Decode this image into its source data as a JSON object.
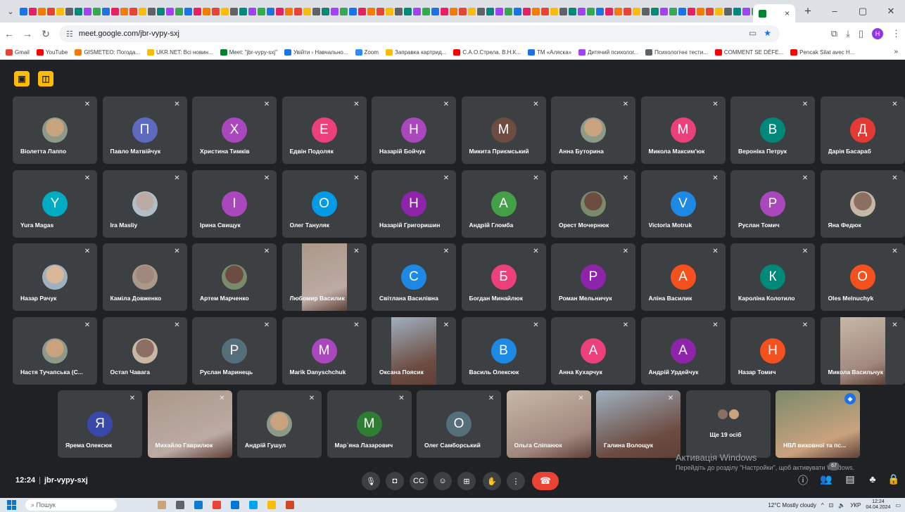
{
  "browser": {
    "url": "meet.google.com/jbr-vypy-sxj",
    "tab_close": "×",
    "new_tab": "+",
    "window_controls": [
      "–",
      "▢",
      "✕"
    ],
    "bookmarks": [
      {
        "label": "Gmail",
        "color": "#ea4335"
      },
      {
        "label": "YouTube",
        "color": "#ff0000"
      },
      {
        "label": "GISMETEO: Погода...",
        "color": "#f57c00"
      },
      {
        "label": "UKR.NET: Всі новин...",
        "color": "#fbbc04"
      },
      {
        "label": "Meet: \"jbr-vypy-sxj\"",
        "color": "#00832d"
      },
      {
        "label": "Увійти › Навчально...",
        "color": "#1a73e8"
      },
      {
        "label": "Zoom",
        "color": "#2d8cff"
      },
      {
        "label": "Заправка картрид...",
        "color": "#fbbc04"
      },
      {
        "label": "С.А.О.Стрела. В.Н.К...",
        "color": "#ff0000"
      },
      {
        "label": "ТМ «Аляска»",
        "color": "#1a73e8"
      },
      {
        "label": "Дитячий психолог...",
        "color": "#a142f4"
      },
      {
        "label": "Психологічні тести...",
        "color": "#5f6368"
      },
      {
        "label": "COMMENT SE DÉFE...",
        "color": "#ff0000"
      },
      {
        "label": "Pencak Silat avec H...",
        "color": "#ff0000"
      }
    ],
    "bookmarks_more": "»"
  },
  "meet": {
    "participants": [
      {
        "name": "Віолетта Лаппо",
        "initial": "",
        "color": "",
        "photo": true
      },
      {
        "name": "Павло Матвійчук",
        "initial": "П",
        "color": "#5c6bc0"
      },
      {
        "name": "Христина Тимків",
        "initial": "Х",
        "color": "#ab47bc"
      },
      {
        "name": "Едвін Подоляк",
        "initial": "Е",
        "color": "#ec407a"
      },
      {
        "name": "Назарій Бойчук",
        "initial": "Н",
        "color": "#ab47bc"
      },
      {
        "name": "Микита Приємський",
        "initial": "М",
        "color": "#6d4c41"
      },
      {
        "name": "Анна Буторина",
        "initial": "",
        "color": "",
        "photo": true
      },
      {
        "name": "Микола Максим'юк",
        "initial": "М",
        "color": "#ec407a"
      },
      {
        "name": "Вероніка Петрук",
        "initial": "В",
        "color": "#00897b"
      },
      {
        "name": "Дарія Басараб",
        "initial": "Д",
        "color": "#e53935"
      },
      {
        "name": "Yura Magas",
        "initial": "Y",
        "color": "#00acc1"
      },
      {
        "name": "Ira Masliy",
        "initial": "",
        "color": "",
        "photo": true
      },
      {
        "name": "Ірина Свищук",
        "initial": "І",
        "color": "#ab47bc"
      },
      {
        "name": "Олег Тануляк",
        "initial": "О",
        "color": "#039be5"
      },
      {
        "name": "Назарій Григоришин",
        "initial": "Н",
        "color": "#8e24aa"
      },
      {
        "name": "Андрій Гломба",
        "initial": "А",
        "color": "#43a047"
      },
      {
        "name": "Орест Мочернюк",
        "initial": "",
        "color": "",
        "photo": true
      },
      {
        "name": "Victoria Motruk",
        "initial": "V",
        "color": "#1e88e5"
      },
      {
        "name": "Руслан Томич",
        "initial": "Р",
        "color": "#ab47bc"
      },
      {
        "name": "Яна Федюк",
        "initial": "",
        "color": "",
        "photo": true
      },
      {
        "name": "Назар Рачук",
        "initial": "",
        "color": "",
        "photo": true
      },
      {
        "name": "Каміла Довженко",
        "initial": "",
        "color": "",
        "photo": true
      },
      {
        "name": "Артем Марченко",
        "initial": "",
        "color": "",
        "photo": true
      },
      {
        "name": "Любомир Василик",
        "initial": "",
        "color": "",
        "video": true
      },
      {
        "name": "Світлана Василівна",
        "initial": "С",
        "color": "#1e88e5"
      },
      {
        "name": "Богдан Минайлюк",
        "initial": "Б",
        "color": "#ec407a"
      },
      {
        "name": "Роман Мельничук",
        "initial": "Р",
        "color": "#8e24aa"
      },
      {
        "name": "Аліна Василик",
        "initial": "А",
        "color": "#f4511e"
      },
      {
        "name": "Кароліна Колотило",
        "initial": "К",
        "color": "#00897b"
      },
      {
        "name": "Oles Melnuchyk",
        "initial": "O",
        "color": "#f4511e"
      },
      {
        "name": "Настя Тучапська (С...",
        "initial": "",
        "color": "",
        "photo": true
      },
      {
        "name": "Остап Чавага",
        "initial": "",
        "color": "",
        "photo": true
      },
      {
        "name": "Руслан Маринець",
        "initial": "Р",
        "color": "#546e7a"
      },
      {
        "name": "Marik Danyschchuk",
        "initial": "M",
        "color": "#ab47bc"
      },
      {
        "name": "Оксана Поясик",
        "initial": "",
        "color": "",
        "video": true
      },
      {
        "name": "Василь Олексюк",
        "initial": "В",
        "color": "#1e88e5"
      },
      {
        "name": "Анна Кухарчук",
        "initial": "А",
        "color": "#ec407a"
      },
      {
        "name": "Андрій Урдейчук",
        "initial": "А",
        "color": "#8e24aa"
      },
      {
        "name": "Назар Томич",
        "initial": "Н",
        "color": "#f4511e"
      },
      {
        "name": "Микола Васильчук",
        "initial": "",
        "color": "",
        "video": true
      },
      {
        "name": "Ярема Олексюк",
        "initial": "Я",
        "color": "#3949ab"
      },
      {
        "name": "Михайло Гаврилюк",
        "initial": "",
        "color": "",
        "video": true
      },
      {
        "name": "Андрій Гушул",
        "initial": "",
        "color": "",
        "photo": true
      },
      {
        "name": "Мар`яна Лазарович",
        "initial": "М",
        "color": "#2e7d32"
      },
      {
        "name": "Олег Самборський",
        "initial": "О",
        "color": "#546e7a"
      },
      {
        "name": "Ольга Сліпанюк",
        "initial": "",
        "color": "",
        "video": true
      },
      {
        "name": "Галина Волощук",
        "initial": "",
        "color": "",
        "video": true
      },
      {
        "name": "Ще 19 осіб",
        "initial": "",
        "color": "",
        "others": true
      },
      {
        "name": "НВЛ виховної та пс...",
        "initial": "",
        "color": "",
        "video": true,
        "selected": true
      }
    ],
    "meeting_time": "12:24",
    "meeting_code": "jbr-vypy-sxj",
    "participants_badge": "67",
    "watermark_title": "Активація Windows",
    "watermark_sub": "Перейдіть до розділу \"Настройки\", щоб активувати Windows."
  },
  "taskbar": {
    "search": "Пошук",
    "weather": "12°C  Mostly cloudy",
    "lang": "УКР",
    "time": "12:24",
    "date": "04.04.2024"
  }
}
